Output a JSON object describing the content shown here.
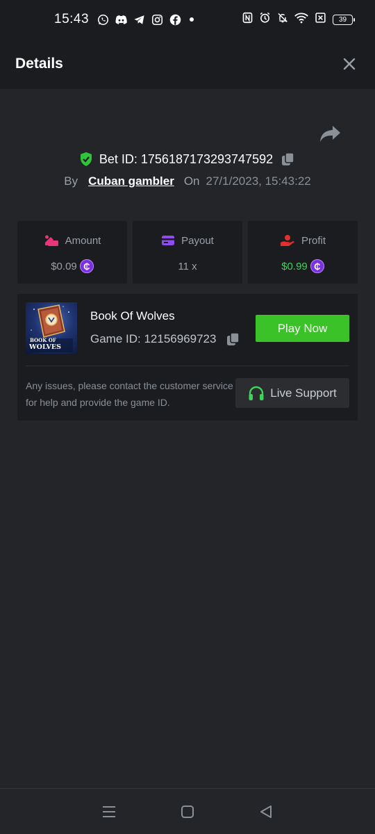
{
  "status_bar": {
    "time": "15:43",
    "battery": "39",
    "app_icons": [
      "whatsapp-icon",
      "discord-icon",
      "telegram-icon",
      "instagram-icon",
      "facebook-icon"
    ],
    "system_icons": [
      "nfc-icon",
      "alarm-icon",
      "mute-icon",
      "wifi-icon",
      "sim-off-icon",
      "battery-icon"
    ]
  },
  "header": {
    "title": "Details"
  },
  "bet": {
    "label": "Bet ID: 1756187173293747592",
    "by_label": "By",
    "user": "Cuban gambler",
    "on_label": "On",
    "date": "27/1/2023, 15:43:22"
  },
  "stats": {
    "amount": {
      "label": "Amount",
      "value": "$0.09"
    },
    "payout": {
      "label": "Payout",
      "value": "11 x"
    },
    "profit": {
      "label": "Profit",
      "value": "$0.99"
    },
    "coin_symbol": "₵"
  },
  "game": {
    "name": "Book Of Wolves",
    "id_label": "Game ID: 12156969723",
    "thumb_text_1": "BOOK OF",
    "thumb_text_2": "WOLVES",
    "play_label": "Play Now",
    "issues_text": "Any issues, please contact the customer service for help and provide the game ID.",
    "support_label": "Live Support"
  },
  "colors": {
    "background": "#232529",
    "panel": "#1b1c1f",
    "accent_green": "#3cc229",
    "profit_green": "#3dd45a",
    "coin_purple": "#7b2fe0",
    "amount_pink": "#e8367a",
    "payout_purple": "#8f4df0",
    "profit_red": "#e0312f"
  }
}
